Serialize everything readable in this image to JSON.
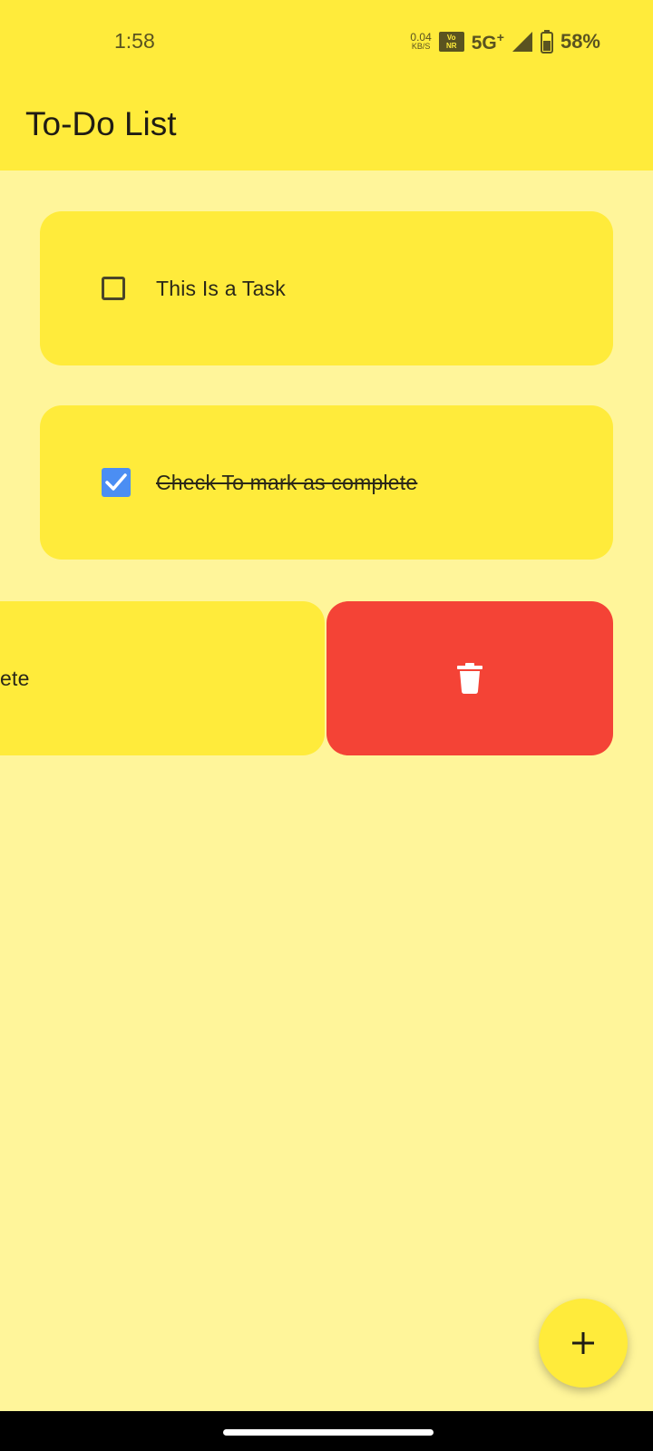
{
  "status_bar": {
    "time": "1:58",
    "net_speed_value": "0.04",
    "net_speed_unit": "KB/S",
    "vonr_top": "Vo",
    "vonr_bottom": "NR",
    "network_type": "5G",
    "network_sup": "+",
    "battery_percent": "58%",
    "icons": [
      "vonr-badge",
      "signal-icon",
      "battery-icon"
    ]
  },
  "app_bar": {
    "title": "To-Do List"
  },
  "tasks": [
    {
      "label": "This Is a Task",
      "completed": false
    },
    {
      "label": "Check To mark as complete",
      "completed": true
    },
    {
      "label": "ete",
      "completed": false
    }
  ],
  "swipe_action": {
    "icon": "trash-icon",
    "color": "#f44336"
  },
  "fab": {
    "icon": "plus-icon"
  },
  "colors": {
    "app_bar": "#ffeb3b",
    "background": "#fff59a",
    "card": "#ffeb3b",
    "checkbox_checked": "#4b8ef3",
    "delete": "#f44336"
  }
}
